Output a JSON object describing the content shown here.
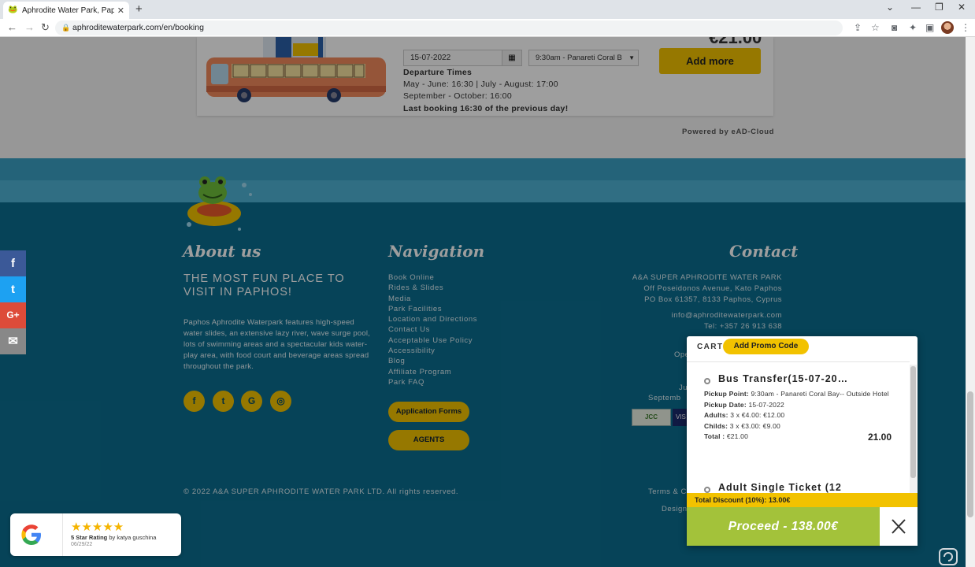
{
  "browser": {
    "tab_title": "Aphrodite Water Park, Paphos, C",
    "tab_close": "✕",
    "new_tab": "+",
    "url": "aphroditewaterpark.com/en/booking"
  },
  "booking": {
    "price": "€21.00",
    "date_value": "15-07-2022",
    "time_value": "9:30am - Panareti Coral B",
    "add_more": "Add more",
    "departure_title": "Departure Times",
    "departure_line1": "May - June: 16:30 | July - August: 17:00",
    "departure_line2": "September - October: 16:00",
    "last_booking": "Last booking 16:30 of the previous day!",
    "powered_by": "Powered by eAD-Cloud"
  },
  "footer": {
    "about_heading": "About us",
    "about_title": "THE MOST FUN PLACE TO VISIT IN PAPHOS!",
    "about_text": "Paphos Aphrodite Waterpark features high-speed water slides, an extensive lazy river, wave surge pool, lots of swimming areas and a spectacular kids water-play area, with food court and beverage areas spread throughout the park.",
    "social": [
      "f",
      "t",
      "G",
      "◎"
    ],
    "nav_heading": "Navigation",
    "nav_items": [
      "Book Online",
      "Rides & Slides",
      "Media",
      "Park Facilities",
      "Location and Directions",
      "Contact Us",
      "Acceptable Use Policy",
      "Accessibility",
      "Blog",
      "Affiliate Program",
      "Park FAQ"
    ],
    "application_forms": "Application Forms",
    "agents": "AGENTS",
    "contact_heading": "Contact",
    "contact_lines": [
      "A&A SUPER APHRODITE WATER PARK",
      "Off Poseidonos Avenue, Kato Paphos",
      "PO Box 61357, 8133 Paphos, Cyprus"
    ],
    "email": "info@aphroditewaterpark.com",
    "tel": "Tel: +357 26 913 638",
    "fragments": [
      "Ope",
      "Ju",
      "Septemb",
      "Terms & C",
      "Designe"
    ],
    "jcc": "JCC",
    "visa": "VIS",
    "copyright": "© 2022 A&A SUPER APHRODITE WATER PARK LTD. All rights reserved."
  },
  "side_social": [
    "f",
    "t",
    "G+",
    "✉"
  ],
  "google_rating": {
    "stars": "★★★★★",
    "rating_label": "5 Star Rating",
    "by": "by katya guschina",
    "date": "06/29/22"
  },
  "cart": {
    "label": "CART",
    "promo": "Add Promo Code",
    "item1": {
      "title": "Bus Transfer(15-07-20…",
      "pickup_point_label": "Pickup Point:",
      "pickup_point": "9:30am - Panareti Coral Bay-- Outside Hotel",
      "pickup_date_label": "Pickup Date:",
      "pickup_date": "15-07-2022",
      "adults_label": "Adults:",
      "adults": "3 x €4.00: €12.00",
      "childs_label": "Childs:",
      "childs": "3 x €3.00: €9.00",
      "total_label": "Total :",
      "total": "€21.00",
      "amount": "21.00"
    },
    "item2_title": "Adult Single Ticket (12",
    "discount": "Total Discount (10%): 13.00€",
    "proceed": "Proceed - 138.00€"
  },
  "colors": {
    "accent_yellow": "#f2c200",
    "footer_blue": "#0b6d8f",
    "proceed_green": "#a3c23a"
  }
}
